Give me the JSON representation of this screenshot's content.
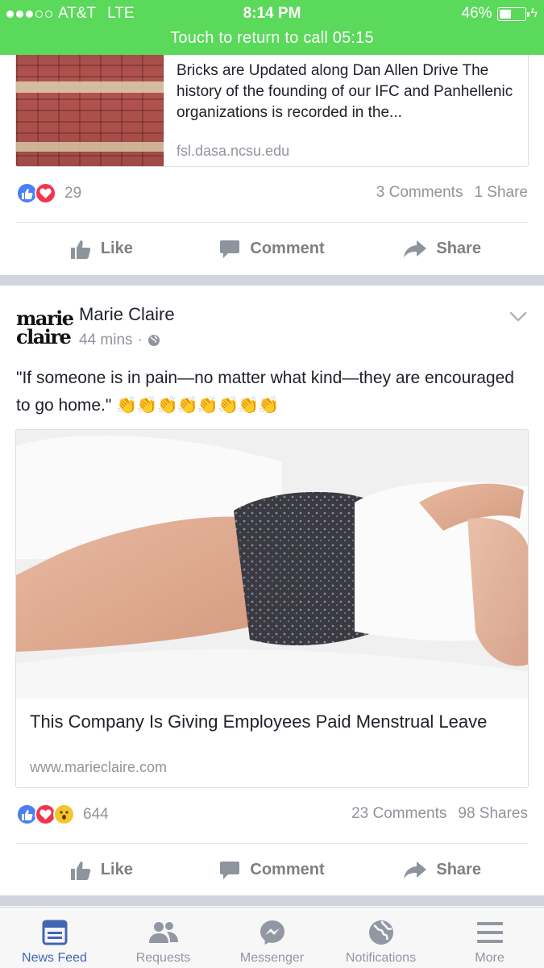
{
  "status_bar": {
    "signal_dots_filled": 3,
    "signal_dots_total": 5,
    "carrier": "AT&T",
    "network": "LTE",
    "time": "8:14 PM",
    "battery": "46%",
    "battery_level": 0.46,
    "call_banner": "Touch to return to call 05:15"
  },
  "prev_post": {
    "link_text": "Bricks are Updated along Dan Allen Drive The history of the founding of our IFC and Panhellenic organizations is recorded in the...",
    "link_domain": "fsl.dasa.ncsu.edu",
    "reaction_count": "29",
    "comments": "3 Comments",
    "shares": "1 Share"
  },
  "post": {
    "author": "Marie Claire",
    "logo_text": "marie claire",
    "time": "44 mins",
    "text": "\"If someone is in pain—no matter what kind—they are encouraged to go home.\"",
    "emojis": "👏👏👏👏👏👏👏👏",
    "article_title": "This Company Is Giving Employees Paid Menstrual Leave",
    "article_domain": "www.marieclaire.com",
    "reaction_count": "644",
    "comments": "23 Comments",
    "shares": "98 Shares"
  },
  "actions": {
    "like": "Like",
    "comment": "Comment",
    "share": "Share"
  },
  "tabs": [
    {
      "label": "News Feed",
      "icon": "news-feed-icon",
      "active": true
    },
    {
      "label": "Requests",
      "icon": "friends-icon",
      "active": false
    },
    {
      "label": "Messenger",
      "icon": "messenger-icon",
      "active": false
    },
    {
      "label": "Notifications",
      "icon": "globe-icon",
      "active": false
    },
    {
      "label": "More",
      "icon": "menu-icon",
      "active": false
    }
  ],
  "colors": {
    "status_bar": "#5ad95a",
    "link_blue": "#4267b2",
    "like_blue": "#4a7ef3",
    "love_red": "#f0354d",
    "wow_yellow": "#f7c42a",
    "divider": "#d1d5db"
  }
}
